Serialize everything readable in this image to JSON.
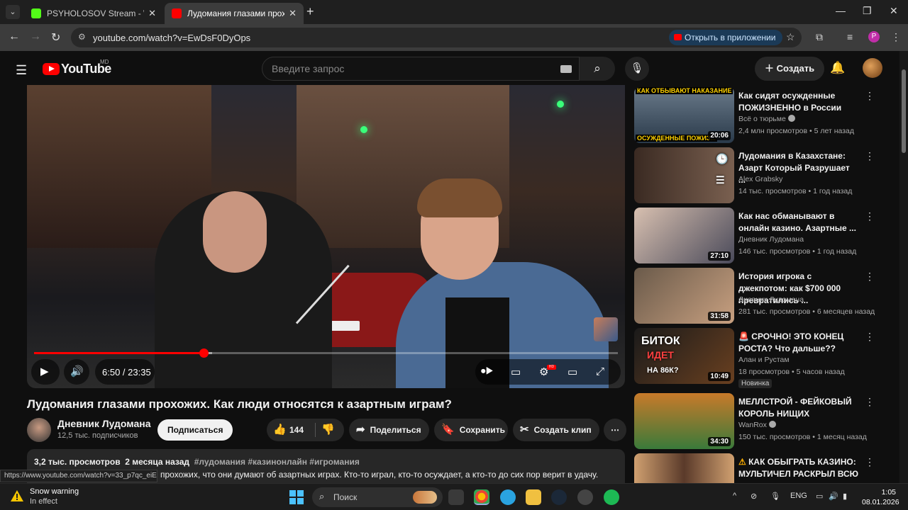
{
  "browser": {
    "tabs": [
      {
        "title": "PSYHOLOSOV Stream - Watch L",
        "active": false,
        "favicon_color": "#53fc18"
      },
      {
        "title": "Лудомания глазами прохожих",
        "active": true,
        "favicon_color": "#ff0000"
      }
    ],
    "url": "youtube.com/watch?v=EwDsF0DyOps",
    "open_in_app": "Открыть в приложении",
    "profile_initial": "P",
    "status_url": "https://www.youtube.com/watch?v=33_p7qc_eiE"
  },
  "youtube": {
    "logo_text": "YouTube",
    "region": "MD",
    "search_placeholder": "Введите запрос",
    "create_label": "Создать"
  },
  "player": {
    "current_time": "6:50",
    "duration": "23:35",
    "time_display": "6:50 / 23:35",
    "progress_played_fraction": 0.29,
    "progress_buffered_fraction": 0.305
  },
  "video": {
    "title": "Лудомания глазами прохожих. Как люди относятся к азартным играм?",
    "channel": "Дневник Лудомана",
    "subscribers": "12,5 тыс. подписчиков",
    "subscribe_label": "Подписаться",
    "likes": "144",
    "share_label": "Поделиться",
    "save_label": "Сохранить",
    "clip_label": "Создать клип",
    "views": "3,2 тыс. просмотров",
    "age": "2 месяца назад",
    "tags": "#лудомания #казинонлайн #игромания",
    "description_line": "прохожих, что они думают об азартных играх. Кто-то играл, кто-то осуждает, а кто-то до сих пор верит в удачу."
  },
  "recommendations": [
    {
      "title": "Как сидят осужденные ПОЖИЗНЕННО в России",
      "channel": "Всё о тюрьме",
      "verified": true,
      "views": "2,4 млн просмотров",
      "age": "5 лет назад",
      "duration": "20:06",
      "thumb_text_top": "КАК ОТБЫВАЮТ НАКАЗАНИЕ",
      "thumb_text_bottom": "ОСУЖДЕННЫЕ ПОЖИЗ..."
    },
    {
      "title": "Лудомания в Казахстане: Азарт Который Разрушает ...",
      "channel": "Alex Grabsky",
      "verified": false,
      "views": "14 тыс. просмотров",
      "age": "1 год назад",
      "duration": ""
    },
    {
      "title": "Как нас обманывают в онлайн казино. Азартные ...",
      "channel": "Дневник Лудомана",
      "verified": false,
      "views": "146 тыс. просмотров",
      "age": "1 год назад",
      "duration": "27:10"
    },
    {
      "title": "История игрока с джекпотом: как $700 000 превратились ...",
      "channel": "Дневник Лудомана",
      "verified": false,
      "views": "281 тыс. просмотров",
      "age": "6 месяцев назад",
      "duration": "31:58"
    },
    {
      "title": "СРОЧНО! ЭТО КОНЕЦ РОСТА? Что дальше??",
      "channel": "Алан и Рустам",
      "verified": false,
      "views": "18 просмотров",
      "age": "5 часов назад",
      "duration": "10:49",
      "badge": "Новинка",
      "thumb_text_1": "БИТОК",
      "thumb_text_2": "ИДЕТ",
      "thumb_text_3": "НА 86К?"
    },
    {
      "title": "МЕЛЛСТРОЙ - ФЕЙКОВЫЙ КОРОЛЬ НИЩИХ",
      "channel": "WanRox",
      "verified": true,
      "views": "150 тыс. просмотров",
      "age": "1 месяц назад",
      "duration": "34:30"
    },
    {
      "title": "КАК ОБЫГРАТЬ КАЗИНО: МУЛЬТИЧЕЛ РАСКРЫЛ ВСЮ ...",
      "channel": "",
      "verified": false,
      "views": "",
      "age": "",
      "duration": ""
    }
  ],
  "taskbar": {
    "weather_title": "Snow warning",
    "weather_sub": "In effect",
    "search_placeholder": "Поиск",
    "language": "ENG",
    "time": "1:05",
    "date": "08.01.2026"
  },
  "colors": {
    "accent_red": "#ff0000",
    "background": "#0f0f0f",
    "pill": "#272727"
  }
}
